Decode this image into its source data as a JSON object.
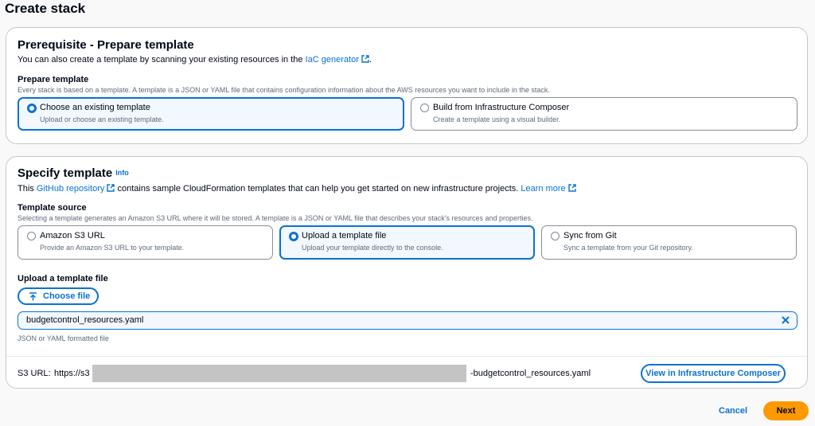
{
  "page": {
    "title": "Create stack"
  },
  "prerequisite": {
    "heading": "Prerequisite - Prepare template",
    "desc_prefix": "You can also create a template by scanning your existing resources in the ",
    "desc_link": "IaC generator",
    "desc_suffix": ".",
    "field_label": "Prepare template",
    "field_desc": "Every stack is based on a template. A template is a JSON or YAML file that contains configuration information about the AWS resources you want to include in the stack.",
    "options": [
      {
        "title": "Choose an existing template",
        "desc": "Upload or choose an existing template.",
        "selected": true
      },
      {
        "title": "Build from Infrastructure Composer",
        "desc": "Create a template using a visual builder.",
        "selected": false
      }
    ]
  },
  "specify": {
    "heading": "Specify template",
    "info_link": "Info",
    "desc_prefix": "This ",
    "desc_link": "GitHub repository",
    "desc_middle": " contains sample CloudFormation templates that can help you get started on new infrastructure projects. ",
    "learn_more": "Learn more",
    "source_label": "Template source",
    "source_desc": "Selecting a template generates an Amazon S3 URL where it will be stored. A template is a JSON or YAML file that describes your stack's resources and properties.",
    "options": [
      {
        "title": "Amazon S3 URL",
        "desc": "Provide an Amazon S3 URL to your template.",
        "selected": false
      },
      {
        "title": "Upload a template file",
        "desc": "Upload your template directly to the console.",
        "selected": true
      },
      {
        "title": "Sync from Git",
        "desc": "Sync a template from your Git repository.",
        "selected": false
      }
    ],
    "upload_label": "Upload a template file",
    "choose_file": "Choose file",
    "file_name": "budgetcontrol_resources.yaml",
    "file_hint": "JSON or YAML formatted file",
    "s3_label": "S3 URL:",
    "s3_prefix": "https://s3",
    "s3_suffix": "-budgetcontrol_resources.yaml",
    "view_composer": "View in Infrastructure Composer"
  },
  "footer": {
    "cancel": "Cancel",
    "next": "Next"
  },
  "colors": {
    "accent": "#0972d3",
    "primary_button": "#ff9900",
    "redaction": "#c4c4c4"
  },
  "icons": [
    "external-link-icon",
    "upload-arrow-icon",
    "close-icon"
  ]
}
